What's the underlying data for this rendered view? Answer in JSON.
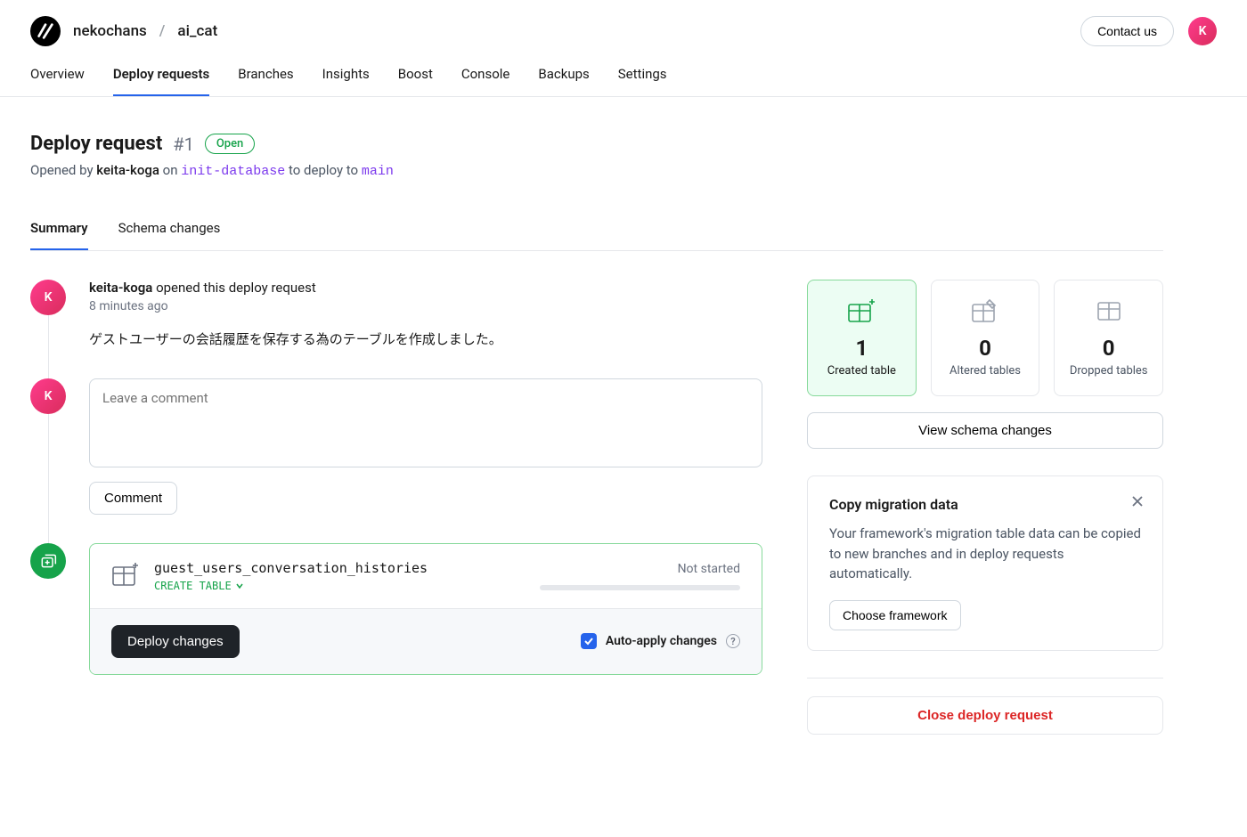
{
  "breadcrumb": {
    "org": "nekochans",
    "repo": "ai_cat"
  },
  "topbar": {
    "contact": "Contact us",
    "avatar_initial": "K"
  },
  "nav": {
    "items": [
      "Overview",
      "Deploy requests",
      "Branches",
      "Insights",
      "Boost",
      "Console",
      "Backups",
      "Settings"
    ],
    "active": "Deploy requests"
  },
  "header": {
    "title": "Deploy request",
    "number": "#1",
    "status": "Open",
    "opened_by_prefix": "Opened by",
    "author": "keita-koga",
    "on_word": "on",
    "source_branch": "init-database",
    "deploy_to_phrase": "to deploy to",
    "target_branch": "main"
  },
  "subtabs": {
    "items": [
      "Summary",
      "Schema changes"
    ],
    "active": "Summary"
  },
  "timeline": {
    "event": {
      "author": "keita-koga",
      "action": "opened this deploy request",
      "time": "8 minutes ago",
      "description": "ゲストユーザーの会話履歴を保存する為のテーブルを作成しました。"
    },
    "comment": {
      "placeholder": "Leave a comment",
      "button": "Comment"
    },
    "deploy": {
      "table_name": "guest_users_conversation_histories",
      "ddl": "CREATE TABLE",
      "status": "Not started",
      "deploy_btn": "Deploy changes",
      "auto_apply": "Auto-apply changes"
    }
  },
  "sidebar": {
    "stats": {
      "created": {
        "count": "1",
        "label": "Created table"
      },
      "altered": {
        "count": "0",
        "label": "Altered tables"
      },
      "dropped": {
        "count": "0",
        "label": "Dropped tables"
      }
    },
    "view_schema": "View schema changes",
    "migration": {
      "title": "Copy migration data",
      "body": "Your framework's migration table data can be copied to new branches and in deploy requests automatically.",
      "button": "Choose framework"
    },
    "close": "Close deploy request"
  }
}
